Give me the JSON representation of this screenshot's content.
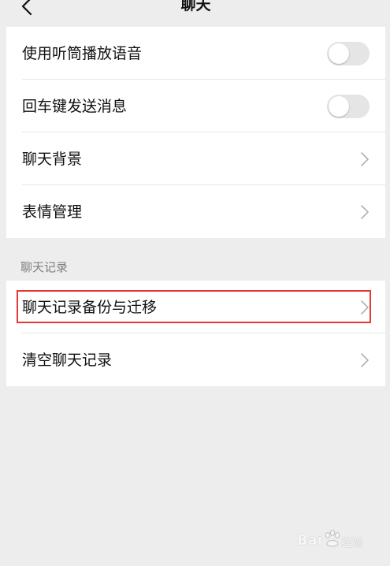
{
  "nav": {
    "title": "聊天",
    "back_icon": "chevron-left-icon"
  },
  "settings": [
    {
      "label": "使用听筒播放语音",
      "control": "toggle",
      "enabled": false
    },
    {
      "label": "回车键发送消息",
      "control": "toggle",
      "enabled": false
    },
    {
      "label": "聊天背景",
      "control": "chevron-right-icon"
    },
    {
      "label": "表情管理",
      "control": "chevron-right-icon"
    }
  ],
  "chat_history": {
    "header": "聊天记录",
    "items": [
      {
        "label": "聊天记录备份与迁移",
        "control": "chevron-right-icon",
        "highlighted": true
      },
      {
        "label": "清空聊天记录",
        "control": "chevron-right-icon"
      }
    ]
  },
  "watermark": {
    "brand": "Bai",
    "suffix": "经验"
  },
  "colors": {
    "background": "#ededed",
    "card": "#ffffff",
    "toggle_off": "#e5e5e5",
    "highlight_border": "#e53935",
    "section_text": "#7f7f7f",
    "chevron": "#b2b2b2"
  }
}
